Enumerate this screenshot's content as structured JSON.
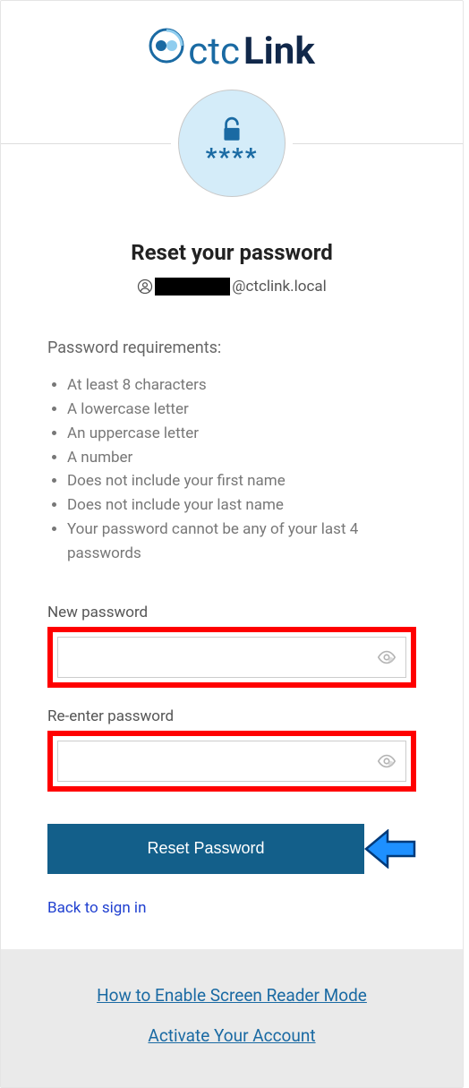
{
  "logo": {
    "ctc": "ctc",
    "link": "Link",
    "asterisks": "****"
  },
  "title": "Reset your password",
  "user": {
    "redacted": "",
    "domain": "@ctclink.local"
  },
  "requirements": {
    "heading": "Password requirements:",
    "items": [
      "At least 8 characters",
      "A lowercase letter",
      "An uppercase letter",
      "A number",
      "Does not include your first name",
      "Does not include your last name",
      "Your password cannot be any of your last 4 passwords"
    ]
  },
  "fields": {
    "new_password_label": "New password",
    "reenter_password_label": "Re-enter password"
  },
  "buttons": {
    "reset": "Reset Password"
  },
  "links": {
    "back": "Back to sign in",
    "screen_reader": "How to Enable Screen Reader Mode",
    "activate": "Activate Your Account"
  }
}
